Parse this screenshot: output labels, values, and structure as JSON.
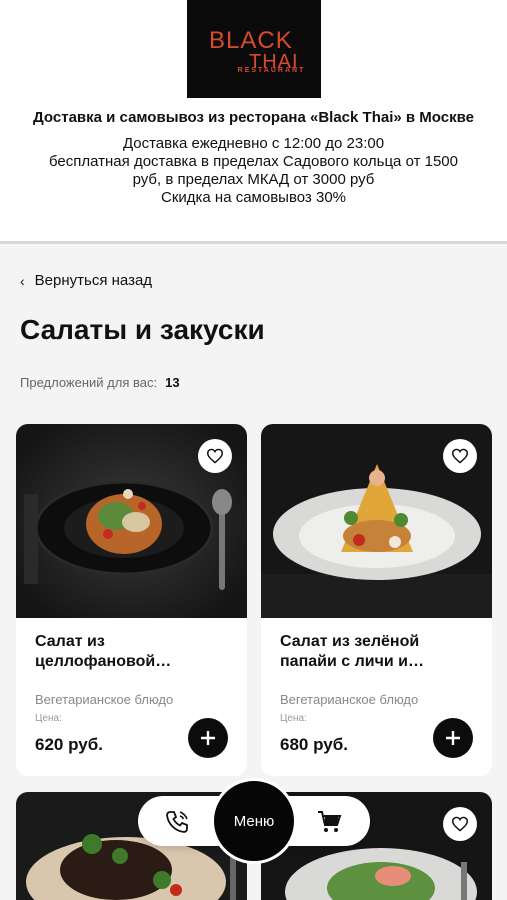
{
  "logo": {
    "line1": "BLACK",
    "line2": "THAI",
    "sub": "RESTAURANT",
    "brand_color": "#d9492e"
  },
  "header": {
    "title": "Доставка и самовывоз из ресторана «Black Thai» в Москве",
    "info": [
      "Доставка ежедневно с 12:00 до 23:00",
      "бесплатная доставка в пределах Садового кольца от 1500",
      "руб, в пределах МКАД от 3000 руб",
      "Скидка на самовывоз 30%"
    ]
  },
  "back": {
    "label": "Вернуться назад"
  },
  "page": {
    "title": "Салаты и закуски",
    "offers_label": "Предложений для вас:",
    "offers_count": "13"
  },
  "cards": [
    {
      "name": "Салат из целлофановой…",
      "category": "Вегетарианское блюдо",
      "price_label": "Цена:",
      "price": "620 руб."
    },
    {
      "name": "Салат из зелёной папайи с личи и…",
      "category": "Вегетарианское блюдо",
      "price_label": "Цена:",
      "price": "680 руб."
    }
  ],
  "bottom": {
    "menu_label": "Меню",
    "phone_icon": "phone-icon",
    "cart_icon": "cart-icon"
  }
}
